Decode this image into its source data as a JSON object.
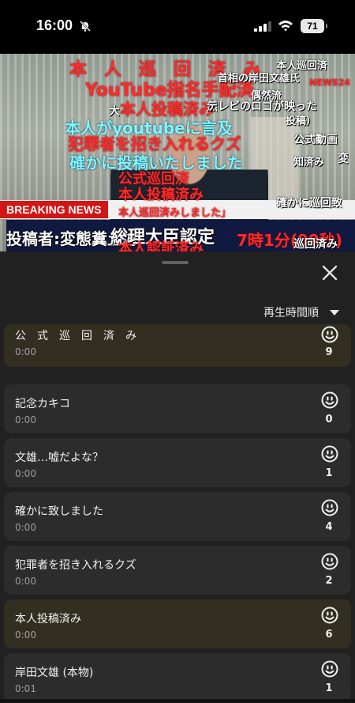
{
  "status_bar": {
    "time": "16:00",
    "battery": "71",
    "icons": [
      "bell-slash-icon",
      "signal-icon",
      "wifi-icon",
      "battery-icon"
    ]
  },
  "video": {
    "breaking": "BREAKING NEWS",
    "danmaku": [
      {
        "text": "本　人　巡　回　済　み",
        "color": "red",
        "size": 22
      },
      {
        "text": "本人巡回済",
        "color": "white",
        "size": 13
      },
      {
        "text": "YouTube指名手配済",
        "color": "red",
        "size": 22
      },
      {
        "text": "首相の岸田文雄氏",
        "color": "white",
        "size": 13
      },
      {
        "text": "NEWS24",
        "color": "red",
        "size": 11
      },
      {
        "text": "本人投稿済み",
        "color": "red",
        "size": 20
      },
      {
        "text": "大",
        "color": "white",
        "size": 14
      },
      {
        "text": "然",
        "color": "white",
        "size": 14
      },
      {
        "text": "偶然流",
        "color": "white",
        "size": 13
      },
      {
        "text": "テレビのロゴが映った",
        "color": "white",
        "size": 14
      },
      {
        "text": "本人がyoutubeに言及",
        "color": "cyan",
        "size": 20
      },
      {
        "text": "投稿）",
        "color": "white",
        "size": 13
      },
      {
        "text": "犯罪者を招き入れるクズ",
        "color": "red",
        "size": 20
      },
      {
        "text": "公式動画",
        "color": "white",
        "size": 14
      },
      {
        "text": "確かに投稿いたしました",
        "color": "cyan",
        "size": 20
      },
      {
        "text": "知済み",
        "color": "white",
        "size": 13
      },
      {
        "text": "変",
        "color": "white",
        "size": 14
      },
      {
        "text": "公式巡回済",
        "color": "red",
        "size": 18
      },
      {
        "text": "本人投稿済み",
        "color": "red",
        "size": 18
      },
      {
        "text": "確かに巡回致",
        "color": "white",
        "size": 14
      },
      {
        "text": "本人巡回済みしました」",
        "color": "red",
        "size": 13
      },
      {
        "text": "投稿者:変態糞土方",
        "color": "white",
        "size": 20
      },
      {
        "text": "総理大臣認定",
        "color": "white",
        "size": 22
      },
      {
        "text": "7時1分(99秒)",
        "color": "red",
        "size": 20
      },
      {
        "text": "本人認証済み",
        "color": "red",
        "size": 18
      },
      {
        "text": "巡回済み",
        "color": "white",
        "size": 14
      }
    ]
  },
  "sheet": {
    "sort_label": "再生時間順",
    "items": [
      {
        "title": "公　式　巡　回　済　み",
        "time": "0:00",
        "count": "9",
        "gold": true
      },
      {
        "title": "記念カキコ",
        "time": "0:00",
        "count": "0",
        "gold": false
      },
      {
        "title": "文雄…嘘だよな？",
        "time": "0:00",
        "count": "1",
        "gold": false
      },
      {
        "title": "確かに致しました",
        "time": "0:00",
        "count": "4",
        "gold": false
      },
      {
        "title": "犯罪者を招き入れるクズ",
        "time": "0:00",
        "count": "2",
        "gold": false
      },
      {
        "title": "本人投稿済み",
        "time": "0:00",
        "count": "6",
        "gold": true
      },
      {
        "title": "岸田文雄 (本物)",
        "time": "0:01",
        "count": "1",
        "gold": false
      }
    ]
  }
}
